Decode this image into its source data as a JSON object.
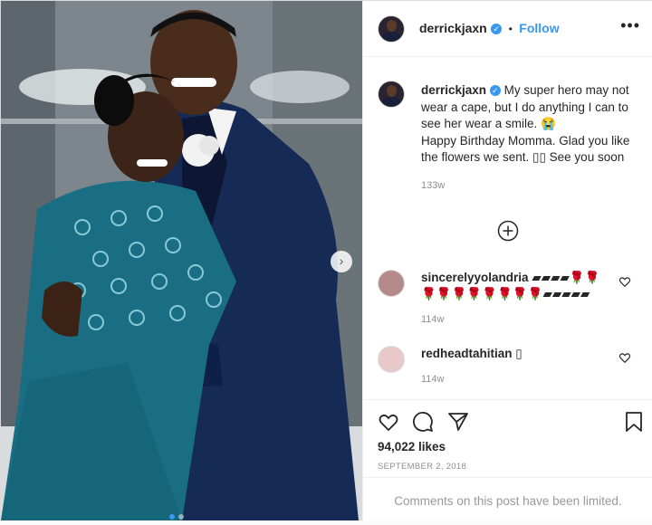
{
  "header": {
    "username": "derrickjaxn",
    "verified_mark": "✓",
    "separator": "•",
    "follow_label": "Follow",
    "more_label": "•••"
  },
  "caption": {
    "username": "derrickjaxn",
    "text_line1": "My super hero may not wear a cape, but I do anything I can to see her wear a smile. 😭",
    "text_line2": "Happy Birthday Momma. Glad you like the flowers we sent. ▯▯ See you soon",
    "time": "133w"
  },
  "comments": [
    {
      "username": "sincerelyyolandria",
      "text": "▰▰▰▰🌹🌹🌹🌹🌹🌹🌹🌹🌹🌹▰▰▰▰▰",
      "time": "114w"
    },
    {
      "username": "redheadtahitian",
      "text": "▯",
      "time": "114w"
    }
  ],
  "likes": "94,022 likes",
  "date": "SEPTEMBER 2, 2018",
  "limited_notice": "Comments on this post have been limited.",
  "carousel_next": "›",
  "icons": {
    "like": "heart-icon",
    "comment": "comment-icon",
    "share": "share-icon",
    "save": "bookmark-icon",
    "load_more": "plus-circle-icon"
  },
  "colors": {
    "accent": "#3897f0",
    "text": "#262626",
    "muted": "#8e8e8e",
    "dress": "#1a6e84",
    "suit": "#152a55"
  }
}
